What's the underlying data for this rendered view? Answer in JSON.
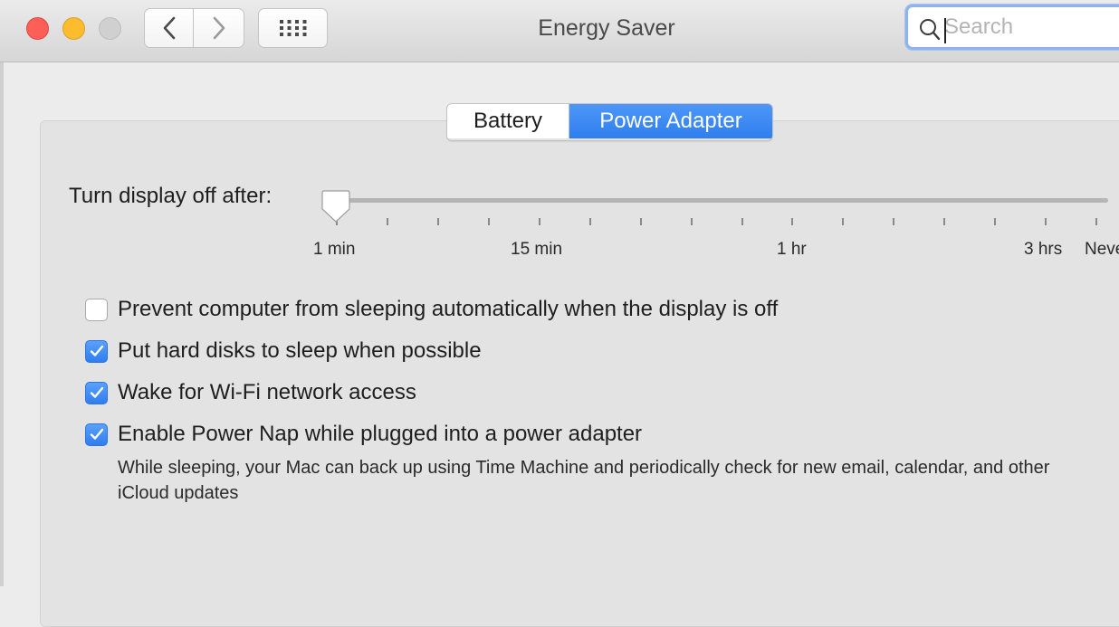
{
  "window": {
    "title": "Energy Saver"
  },
  "search": {
    "placeholder": "Search",
    "value": ""
  },
  "icons": {
    "back": "chevron-left-icon",
    "forward": "chevron-right-icon",
    "grid": "show-all-grid-icon",
    "search": "magnifier-icon",
    "checkmark": "checkmark-icon"
  },
  "tabs": [
    {
      "label": "Battery",
      "selected": false
    },
    {
      "label": "Power Adapter",
      "selected": true
    }
  ],
  "display_sleep": {
    "label": "Turn display off after:",
    "value": "1 min",
    "tick_labels": [
      "1 min",
      "15 min",
      "1 hr",
      "3 hrs",
      "Never"
    ]
  },
  "options": [
    {
      "label": "Prevent computer from sleeping automatically when the display is off",
      "checked": false
    },
    {
      "label": "Put hard disks to sleep when possible",
      "checked": true
    },
    {
      "label": "Wake for Wi-Fi network access",
      "checked": true
    },
    {
      "label": "Enable Power Nap while plugged into a power adapter",
      "checked": true
    }
  ],
  "power_nap_description": "While sleeping, your Mac can back up using Time Machine and periodically check for new email, calendar, and other iCloud updates",
  "colors": {
    "accent": "#2f7ef0",
    "close": "#fc5f57",
    "minimize": "#fdbc2e",
    "zoom_disabled": "#d0d0d0"
  }
}
